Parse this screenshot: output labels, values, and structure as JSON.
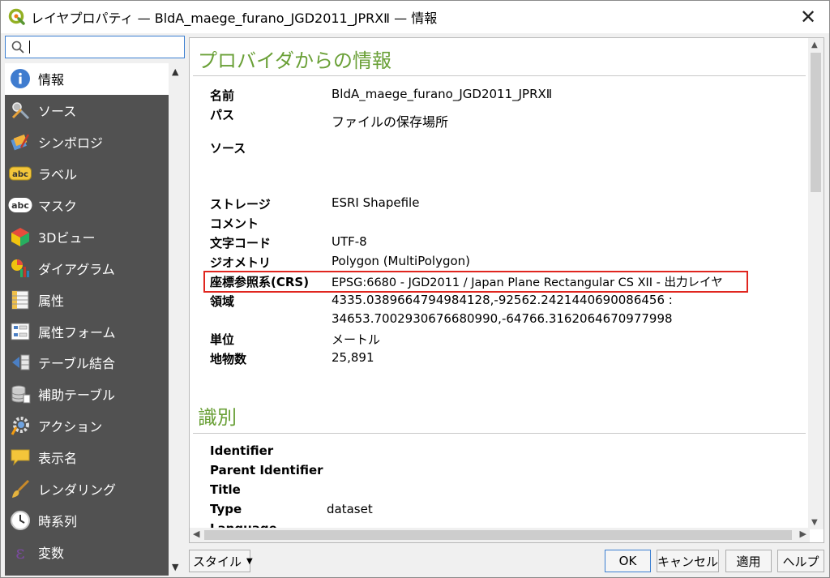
{
  "window": {
    "title": "レイヤプロパティ — BldA_maege_furano_JGD2011_JPRXⅡ — 情報",
    "close_label": "✕"
  },
  "search": {
    "placeholder": ""
  },
  "nav": {
    "items": [
      {
        "label": "情報",
        "icon": "info-icon"
      },
      {
        "label": "ソース",
        "icon": "source-tools-icon"
      },
      {
        "label": "シンボロジ",
        "icon": "symbology-brush-icon"
      },
      {
        "label": "ラベル",
        "icon": "label-abc-icon"
      },
      {
        "label": "マスク",
        "icon": "mask-abc-icon"
      },
      {
        "label": "3Dビュー",
        "icon": "3d-cube-icon"
      },
      {
        "label": "ダイアグラム",
        "icon": "diagram-icon"
      },
      {
        "label": "属性",
        "icon": "attributes-table-icon"
      },
      {
        "label": "属性フォーム",
        "icon": "attribute-form-icon"
      },
      {
        "label": "テーブル結合",
        "icon": "join-icon"
      },
      {
        "label": "補助テーブル",
        "icon": "auxiliary-storage-icon"
      },
      {
        "label": "アクション",
        "icon": "action-gear-icon"
      },
      {
        "label": "表示名",
        "icon": "display-speech-icon"
      },
      {
        "label": "レンダリング",
        "icon": "rendering-brush-icon"
      },
      {
        "label": "時系列",
        "icon": "clock-icon"
      },
      {
        "label": "変数",
        "icon": "variables-epsilon-icon"
      }
    ]
  },
  "provider": {
    "heading": "プロバイダからの情報",
    "rows": [
      {
        "key": "名前",
        "value": "BldA_maege_furano_JGD2011_JPRXⅡ"
      },
      {
        "key": "パス",
        "value": "ファイルの保存場所"
      },
      {
        "key": "ソース",
        "value": ""
      },
      {
        "key": "ストレージ",
        "value": "ESRI Shapefile"
      },
      {
        "key": "コメント",
        "value": ""
      },
      {
        "key": "文字コード",
        "value": "UTF-8"
      },
      {
        "key": "ジオメトリ",
        "value": "Polygon (MultiPolygon)"
      },
      {
        "key": "座標参照系(CRS)",
        "value": "EPSG:6680 - JGD2011 / Japan Plane Rectangular CS XII - 出力レイヤ"
      },
      {
        "key": "領域",
        "value": "4335.0389664794984128,-92562.2421440690086456 :"
      },
      {
        "key": "",
        "value": "34653.7002930676680990,-64766.3162064670977998"
      },
      {
        "key": "単位",
        "value": "メートル"
      },
      {
        "key": "地物数",
        "value": "25,891"
      }
    ]
  },
  "identification": {
    "heading": "識別",
    "rows": [
      {
        "key": "Identifier",
        "value": ""
      },
      {
        "key": "Parent Identifier",
        "value": ""
      },
      {
        "key": "Title",
        "value": ""
      },
      {
        "key": "Type",
        "value": "dataset"
      },
      {
        "key": "Language",
        "value": ""
      }
    ]
  },
  "footer": {
    "style_label": "スタイル",
    "ok_label": "OK",
    "cancel_label": "キャンセル",
    "apply_label": "適用",
    "help_label": "ヘルプ"
  },
  "colors": {
    "heading_green": "#6aa037",
    "nav_bg": "#515151",
    "highlight_red": "#e0261f"
  }
}
